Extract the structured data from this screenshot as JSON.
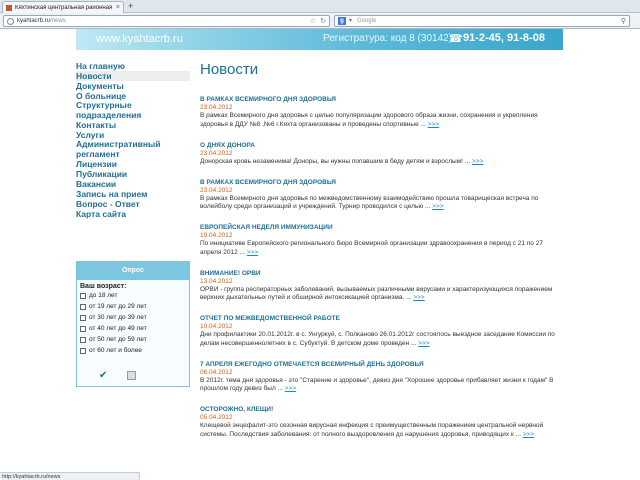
{
  "browser": {
    "tab_title": "Кяхтинская центральная районная больн...",
    "tab_close": "×",
    "new_tab": "+",
    "url_host": "kyahtacrb.ru",
    "url_path": "/news",
    "search_placeholder": "Google",
    "search_engine_icon": "google-icon",
    "status_text": "http://kyahtacrb.ru/news"
  },
  "header": {
    "site_name": "www.kyahtacrb.ru",
    "registry": "Регистратура: код 8 (30142)",
    "phones": "91-2-45, 91-8-08"
  },
  "nav": {
    "items": [
      "На главную",
      "Новости",
      "Документы",
      "О больнице",
      "Структурные подразделения",
      "Контакты",
      "Услуги",
      "Административный регламент",
      "Лицензии",
      "Публикации",
      "Вакансии",
      "Запись на прием",
      "Вопрос - Ответ",
      "Карта сайта"
    ],
    "active": "Новости"
  },
  "poll": {
    "header": "Опрос",
    "question": "Ваш возраст:",
    "options": [
      "до 18 лет",
      "от 19 лет до 29 лет",
      "от 30 лет до 39 лет",
      "от 40 лет до 49 лет",
      "от 50 лет до 59 лет",
      "от 60 лет и более"
    ]
  },
  "main": {
    "title": "Новости",
    "more": ">>>",
    "news": [
      {
        "title": "В РАМКАХ ВСЕМИРНОГО ДНЯ ЗДОРОВЬЯ",
        "date": "23.04.2012",
        "text": "В рамках Всемирного дня здоровья с целью популяризации здорового образа жизни, сохранения и укрепления здоровья в ДДУ №8 ,№6 г.Кяхта организованы и проведены спортивные ..."
      },
      {
        "title": "О ДНЯХ ДОНОРА",
        "date": "23.04.2012",
        "text": "Донорская кровь незаменима! Доноры, вы нужны попавшим в беду детям и взрослым! ..."
      },
      {
        "title": "В РАМКАХ ВСЕМИРНОГО ДНЯ ЗДОРОВЬЯ",
        "date": "23.04.2012",
        "text": "В рамках Всемирного дня здоровья по межведомственному взаимодействию прошла товарищеская встреча по волейболу среди организаций и учреждений. Турнир проводился с целью ..."
      },
      {
        "title": "ЕВРОПЕЙСКАЯ НЕДЕЛЯ ИММУНИЗАЦИИ",
        "date": "19.04.2012",
        "text": "По инициативе Европейского регионального бюро Всемирной организации здравоохранения в период с 21 по 27 апреля 2012 ..."
      },
      {
        "title": "ВНИМАНИЕ! ОРВИ",
        "date": "13.04.2012",
        "text": "ОРВИ - группа респираторных заболеваний, вызываемых различными вирусами и характеризующихся поражением верхних дыхательных путей и обширной интоксикацией организма. ..."
      },
      {
        "title": "ОТЧЕТ ПО МЕЖВЕДОМСТВЕННОЙ РАБОТЕ",
        "date": "10.04.2012",
        "text": "Дни профилактики 20.01.2012г. в с. Унгуркуй, с. Полканово 26.01.2012г состоялось выездное заседание Комиссии по делам несовершеннолетних в с. Субуктуй. В детском доме проведен ..."
      },
      {
        "title": "7 АПРЕЛЯ ЕЖЕГОДНО ОТМЕЧАЕТСЯ ВСЕМИРНЫЙ ДЕНЬ ЗДОРОВЬЯ",
        "date": "06.04.2012",
        "text": "В 2012г. тема дня здоровья - это \"Старение и здоровье\", девиз дня \"Хорошее здоровье прибавляет жизни к годам\" В прошлом году девиз был ..."
      },
      {
        "title": "ОСТОРОЖНО, КЛЕЩИ!",
        "date": "05.04.2012",
        "text": "Клещевой энцефалит-это сезонная вирусная инфекция с преимущественным поражением центральной нервной системы. Последствия заболевания: от полного выздоровления до нарушения здоровья, приводящих к ..."
      }
    ]
  }
}
